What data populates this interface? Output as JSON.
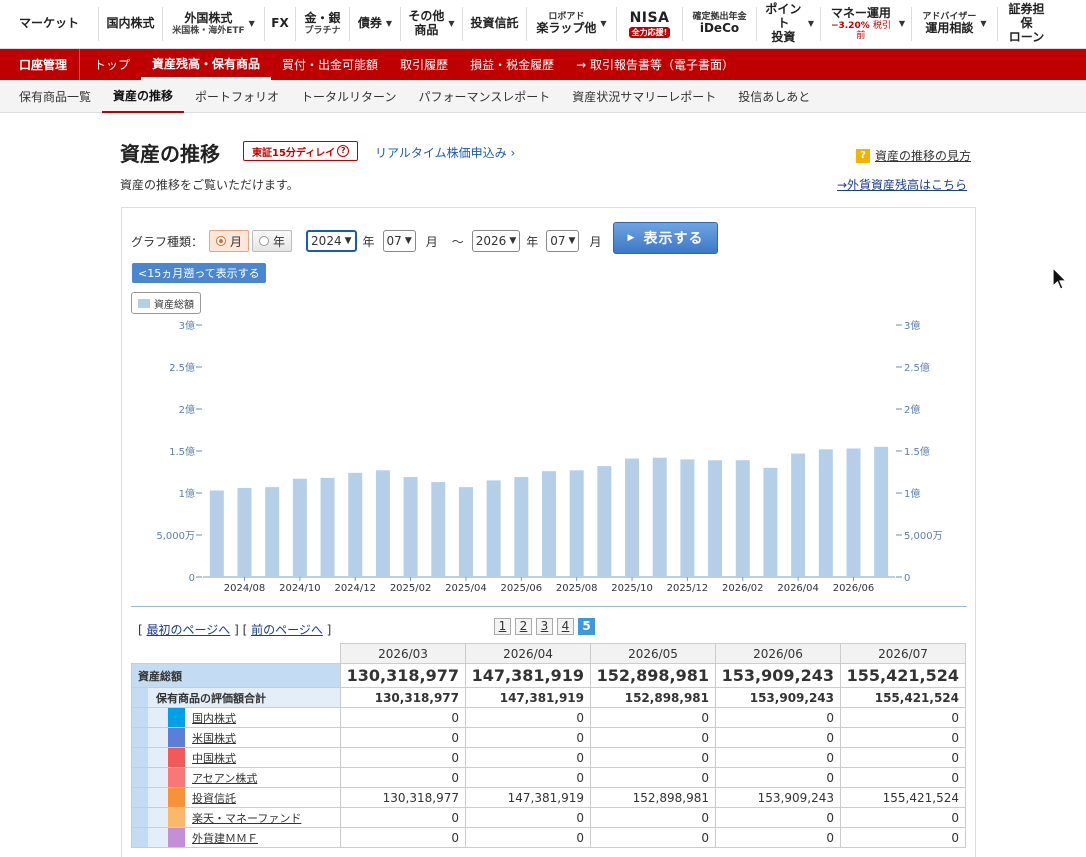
{
  "topnav": {
    "market": "マーケット",
    "domestic": "国内株式",
    "foreign_l1": "外国株式",
    "foreign_l2": "米国株・海外ETF",
    "fx": "FX",
    "gold_l1": "金・銀",
    "gold_l2": "プラチナ",
    "bonds": "債券",
    "other_l1": "その他",
    "other_l2": "商品",
    "funds": "投資信託",
    "robo_l1": "ロボアド",
    "robo_l2": "楽ラップ他",
    "nisa_l1": "NISA",
    "nisa_badge": "全力応援!",
    "ideco_l1": "確定拠出年金",
    "ideco_l2": "iDeCo",
    "point_l1": "ポイント",
    "point_l2": "投資",
    "money_l1": "マネー運用",
    "money_l2a": "−3.20%",
    "money_l2b": "税引前",
    "adviser_l1": "アドバイザー",
    "adviser_l2": "運用相談",
    "loan_l1": "証券担保",
    "loan_l2": "ローン"
  },
  "redbar": {
    "account": "口座管理",
    "items": [
      "トップ",
      "資産残高・保有商品",
      "買付・出金可能額",
      "取引履歴",
      "損益・税金履歴",
      "→ 取引報告書等（電子書面）"
    ]
  },
  "subnav": {
    "items": [
      "保有商品一覧",
      "資産の推移",
      "ポートフォリオ",
      "トータルリターン",
      "パフォーマンスレポート",
      "資産状況サマリーレポート",
      "投信あしあと"
    ]
  },
  "header": {
    "title": "資産の推移",
    "delay_badge": "東証15分ディレイ",
    "delay_q": "?",
    "realtime_link": "リアルタイム株価申込み ›",
    "howto_icon": "?",
    "howto_link": "資産の推移の見方",
    "description": "資産の推移をご覧いただけます。",
    "fx_link": "→外貨資産残高はこちら"
  },
  "controls": {
    "graph_type_label": "グラフ種類：",
    "month_label": "月",
    "year_label": "年",
    "from_year": "2024",
    "from_month": "07",
    "to_year": "2026",
    "to_month": "07",
    "year_unit": "年",
    "month_unit": "月",
    "tilde": "〜",
    "show_button": "表示する",
    "back15_button": "<15ヵ月遡って表示する",
    "legend": "資産総額"
  },
  "chart_data": {
    "type": "bar",
    "series": [
      {
        "name": "資産総額",
        "values": [
          1.03,
          1.06,
          1.07,
          1.17,
          1.18,
          1.24,
          1.27,
          1.19,
          1.13,
          1.07,
          1.15,
          1.19,
          1.26,
          1.27,
          1.32,
          1.41,
          1.42,
          1.4,
          1.39,
          1.39,
          1.3,
          1.47,
          1.52,
          1.53,
          1.55
        ]
      }
    ],
    "x_tick_labels": [
      "2024/08",
      "2024/10",
      "2024/12",
      "2025/02",
      "2025/04",
      "2025/06",
      "2025/08",
      "2025/10",
      "2025/12",
      "2026/02",
      "2026/04",
      "2026/06"
    ],
    "y_ticks": [
      "0",
      "5,000万",
      "1億",
      "1.5億",
      "2億",
      "2.5億",
      "3億"
    ],
    "ylim": [
      0,
      3
    ],
    "grid": false,
    "color": "#b6cfe8"
  },
  "pager": {
    "first": "最初のページへ",
    "prev": "前のページへ",
    "pages": [
      "1",
      "2",
      "3",
      "4",
      "5"
    ],
    "current": "5"
  },
  "table": {
    "months": [
      "2026/03",
      "2026/04",
      "2026/05",
      "2026/06",
      "2026/07"
    ],
    "total_label": "資産総額",
    "totals": [
      "130,318,977",
      "147,381,919",
      "152,898,981",
      "153,909,243",
      "155,421,524"
    ],
    "holdings_label": "保有商品の評価額合計",
    "holdings": [
      "130,318,977",
      "147,381,919",
      "152,898,981",
      "153,909,243",
      "155,421,524"
    ],
    "rows": [
      {
        "label": "国内株式",
        "color": "#00a0e9",
        "values": [
          "0",
          "0",
          "0",
          "0",
          "0"
        ]
      },
      {
        "label": "米国株式",
        "color": "#5b7fd6",
        "values": [
          "0",
          "0",
          "0",
          "0",
          "0"
        ]
      },
      {
        "label": "中国株式",
        "color": "#f05a5a",
        "values": [
          "0",
          "0",
          "0",
          "0",
          "0"
        ]
      },
      {
        "label": "アセアン株式",
        "color": "#f87878",
        "values": [
          "0",
          "0",
          "0",
          "0",
          "0"
        ]
      },
      {
        "label": "投資信託",
        "color": "#f7923a",
        "values": [
          "130,318,977",
          "147,381,919",
          "152,898,981",
          "153,909,243",
          "155,421,524"
        ]
      },
      {
        "label": "楽天・マネーファンド",
        "color": "#fbb86a",
        "values": [
          "0",
          "0",
          "0",
          "0",
          "0"
        ]
      },
      {
        "label": "外貨建ＭＭＦ",
        "color": "#c58fd8",
        "values": [
          "0",
          "0",
          "0",
          "0",
          "0"
        ]
      }
    ]
  }
}
